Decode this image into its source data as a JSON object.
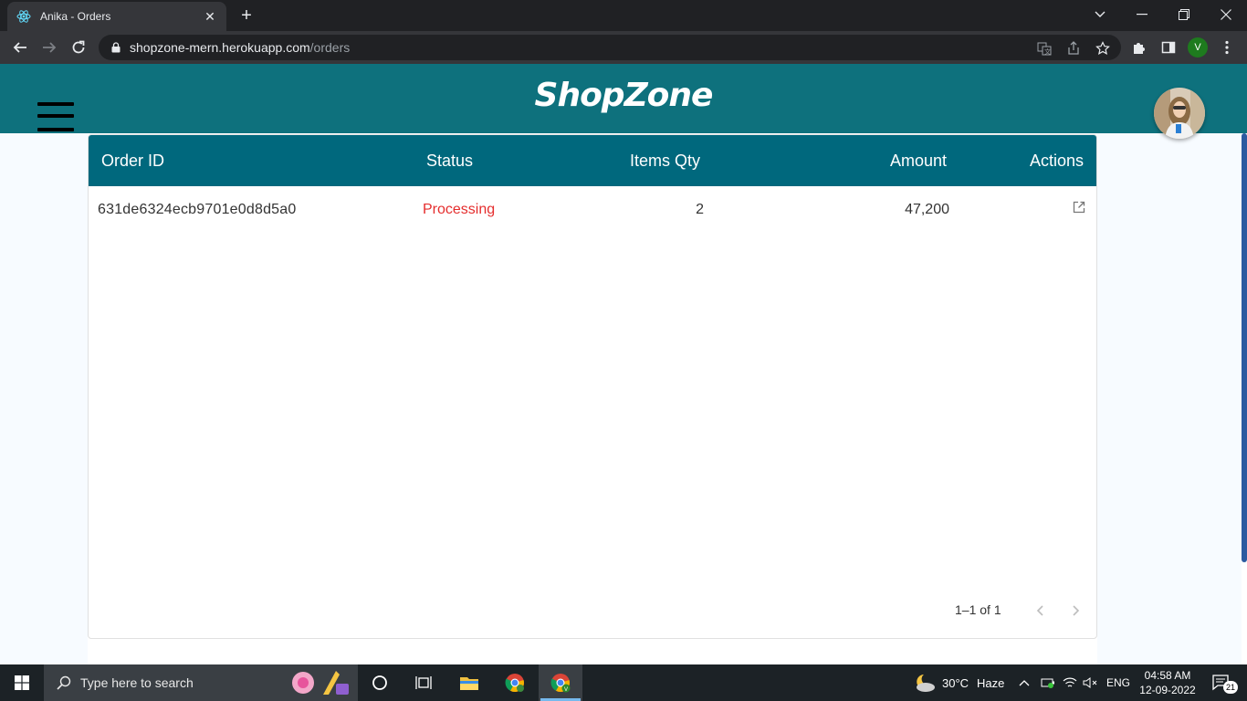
{
  "browser": {
    "tab_title": "Anika - Orders",
    "tab_close": "✕",
    "new_tab": "+",
    "url_host": "shopzone-mern.herokuapp.com",
    "url_path": "/orders",
    "profile_initial": "V"
  },
  "app": {
    "brand": "ShopZone",
    "colors": {
      "appbar": "#0e717d",
      "header": "#00687d",
      "status_processing": "#e52d2d"
    }
  },
  "orders": {
    "columns": [
      "Order ID",
      "Status",
      "Items Qty",
      "Amount",
      "Actions"
    ],
    "rows": [
      {
        "order_id": "631de6324ecb9701e0d8d5a0",
        "status": "Processing",
        "items_qty": "2",
        "amount": "47,200",
        "action_icon": "open-in-new-icon"
      }
    ],
    "pagination": "1–1 of 1"
  },
  "taskbar": {
    "search_placeholder": "Type here to search",
    "weather_temp": "30°C",
    "weather_desc": "Haze",
    "language": "ENG",
    "time": "04:58 AM",
    "date": "12-09-2022",
    "notifications": "21"
  }
}
